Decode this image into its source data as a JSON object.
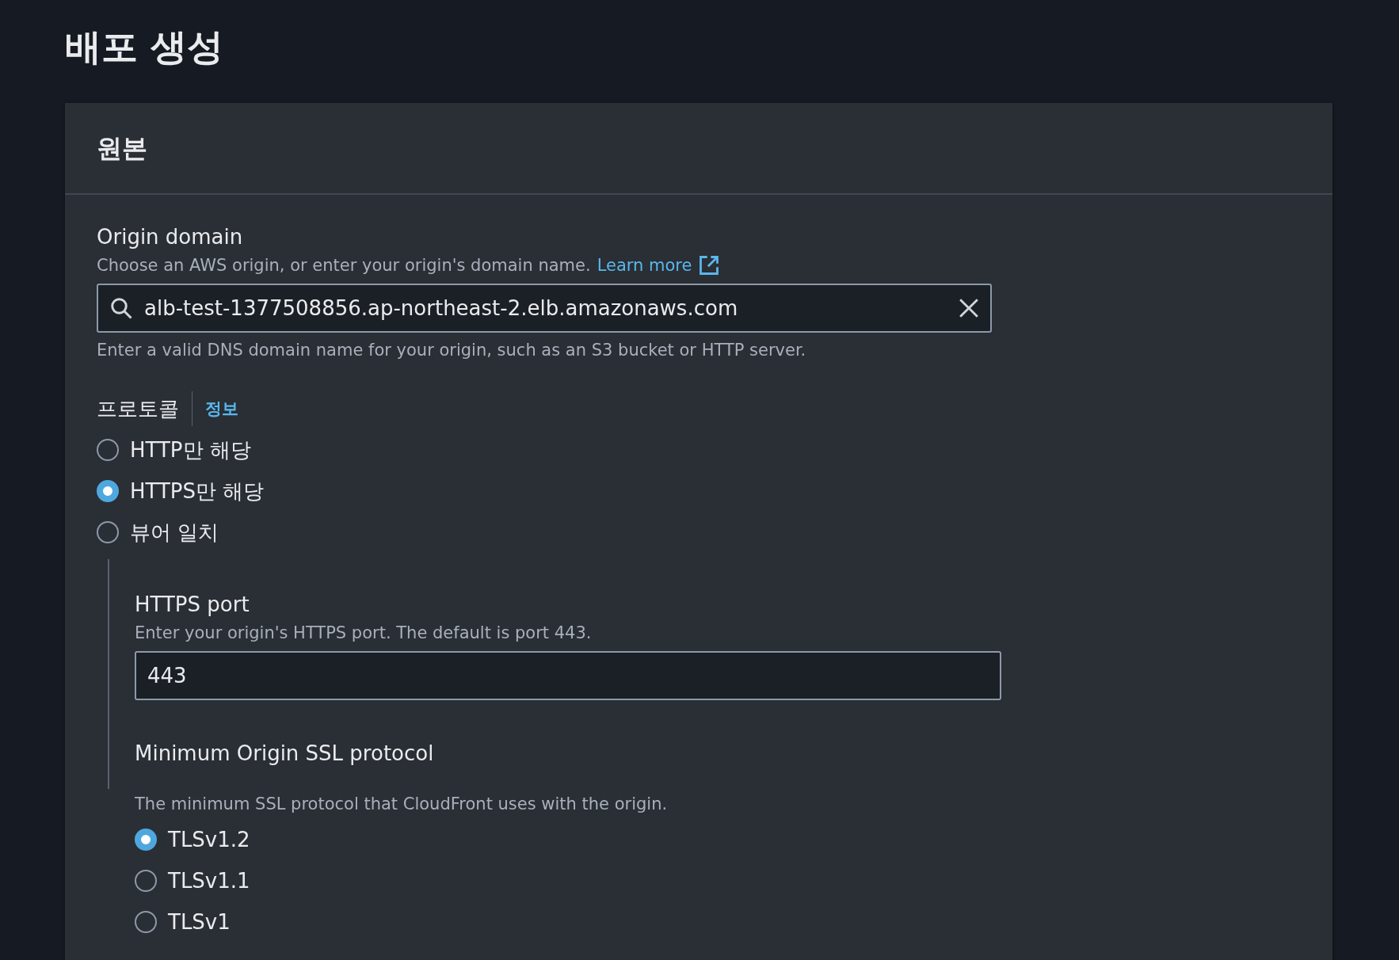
{
  "page_title": "배포 생성",
  "panel": {
    "title": "원본",
    "origin_domain": {
      "label": "Origin domain",
      "description": "Choose an AWS origin, or enter your origin's domain name.",
      "link": "Learn more",
      "value": "alb-test-1377508856.ap-northeast-2.elb.amazonaws.com",
      "hint": "Enter a valid DNS domain name for your origin, such as an S3 bucket or HTTP server."
    },
    "protocol": {
      "label": "프로토콜",
      "info": "정보",
      "options": [
        {
          "label": "HTTP만 해당",
          "selected": false
        },
        {
          "label": "HTTPS만 해당",
          "selected": true
        },
        {
          "label": "뷰어 일치",
          "selected": false
        }
      ]
    },
    "https_port": {
      "label": "HTTPS port",
      "description": "Enter your origin's HTTPS port. The default is port 443.",
      "value": "443"
    },
    "min_ssl": {
      "label": "Minimum Origin SSL protocol",
      "description": "The minimum SSL protocol that CloudFront uses with the origin.",
      "options": [
        {
          "label": "TLSv1.2",
          "selected": true
        },
        {
          "label": "TLSv1.1",
          "selected": false
        },
        {
          "label": "TLSv1",
          "selected": false
        }
      ]
    }
  }
}
